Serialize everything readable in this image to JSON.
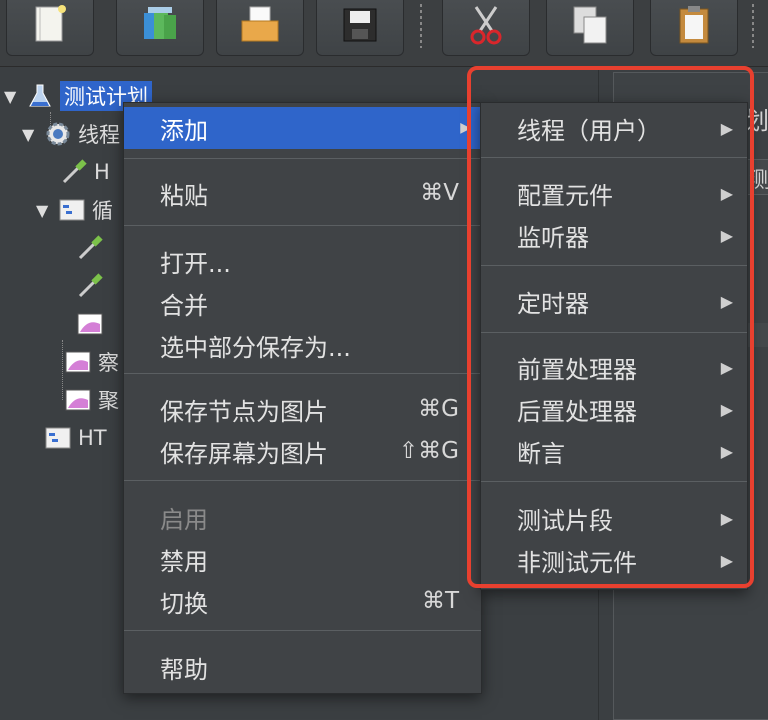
{
  "toolbar": {
    "buttons": [
      "new-file-icon",
      "templates-icon",
      "open-folder-icon",
      "save-icon",
      "cut-icon",
      "copy-icon",
      "paste-icon"
    ]
  },
  "tree": {
    "test_plan": "测试计划",
    "thread_group": "线程",
    "http_1": "H",
    "loop": "循",
    "view_results": "察",
    "aggregate": "聚",
    "http_defaults": "HT"
  },
  "right_panel": {
    "title_partial": "划",
    "field_partial": "测"
  },
  "context_menu": {
    "add": "添加",
    "paste": "粘贴",
    "paste_shortcut": "⌘V",
    "open": "打开...",
    "merge": "合并",
    "save_selection": "选中部分保存为...",
    "save_node_image": "保存节点为图片",
    "save_node_image_shortcut": "⌘G",
    "save_screen_image": "保存屏幕为图片",
    "save_screen_image_shortcut": "⇧⌘G",
    "enable": "启用",
    "disable": "禁用",
    "toggle": "切换",
    "toggle_shortcut": "⌘T",
    "help": "帮助"
  },
  "submenu": {
    "threads": "线程（用户）",
    "config_element": "配置元件",
    "listener": "监听器",
    "timer": "定时器",
    "pre_processor": "前置处理器",
    "post_processor": "后置处理器",
    "assertion": "断言",
    "test_fragment": "测试片段",
    "non_test_elements": "非测试元件"
  },
  "colors": {
    "highlight": "#2f65ca",
    "annotation_box": "#e8402f",
    "menu_bg": "#404346"
  }
}
